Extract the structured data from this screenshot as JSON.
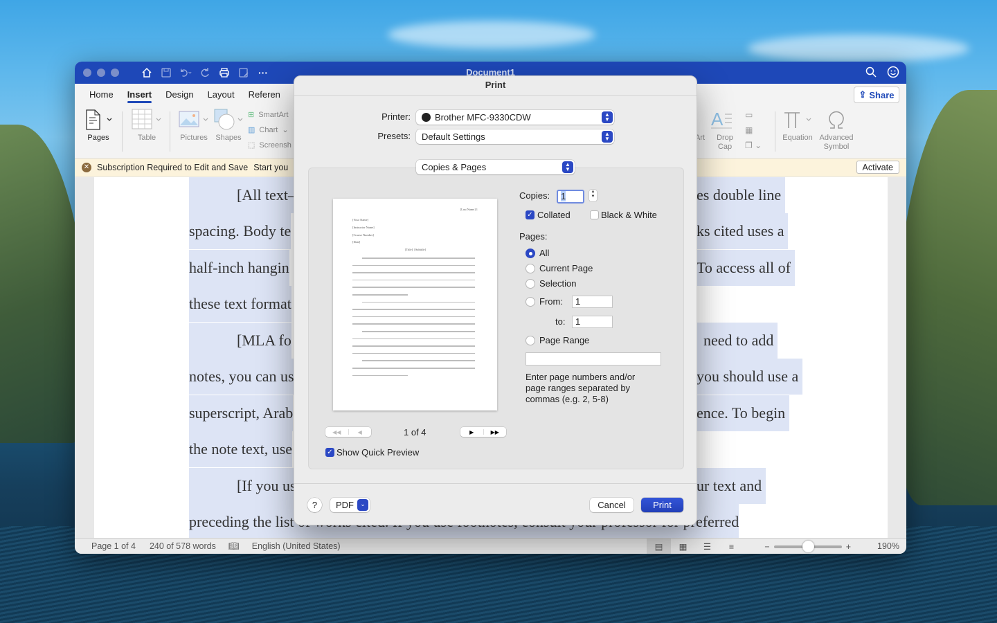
{
  "window": {
    "title": "Document1",
    "traffic_lights": [
      "close",
      "minimize",
      "zoom"
    ],
    "quick_access": [
      "home-icon",
      "save-icon",
      "undo-icon",
      "redo-icon",
      "print-icon",
      "save-as-icon",
      "more-icon"
    ]
  },
  "ribbon": {
    "tabs": [
      {
        "label": "Home",
        "active": false
      },
      {
        "label": "Insert",
        "active": true
      },
      {
        "label": "Design",
        "active": false
      },
      {
        "label": "Layout",
        "active": false
      },
      {
        "label": "Referen",
        "active": false
      }
    ],
    "share_label": "Share",
    "groups": {
      "pages": "Pages",
      "table": "Table",
      "pictures": "Pictures",
      "shapes": "Shapes",
      "smartart": "SmartArt",
      "chart": "Chart",
      "screenshot": "Screensh",
      "wordart_partial": "Art",
      "dropcap": "Drop Cap",
      "equation": "Equation",
      "advanced_symbol": "Advanced Symbol"
    }
  },
  "message_bar": {
    "title": "Subscription Required to Edit and Save",
    "text": "Start you",
    "activate_label": "Activate"
  },
  "document": {
    "left_lines": [
      "[All text–",
      "spacing. Body te",
      "half-inch hangin",
      "these text format",
      "[MLA fo",
      "notes, you can us",
      "superscript, Arab",
      "the note text, use",
      "[If you us",
      "preceding the list of works cited. If you use footnotes, consult your professor for preferred"
    ],
    "right_lines": [
      "es double line",
      "ks cited uses a",
      "To access all of",
      "",
      "need to add",
      "you should use a",
      "ence. To begin",
      "",
      "ur text and",
      ""
    ]
  },
  "statusbar": {
    "page": "Page 1 of 4",
    "words": "240 of 578 words",
    "language": "English (United States)",
    "zoom": "190%",
    "zoom_fraction": 0.5
  },
  "print_dialog": {
    "title": "Print",
    "printer_label": "Printer:",
    "printer_value": "Brother MFC-9330CDW",
    "presets_label": "Presets:",
    "presets_value": "Default Settings",
    "section_value": "Copies & Pages",
    "copies_label": "Copies:",
    "copies_value": "1",
    "collated_label": "Collated",
    "collated_checked": true,
    "bw_label": "Black & White",
    "bw_checked": false,
    "pages_label": "Pages:",
    "pages_options": [
      {
        "label": "All",
        "selected": true
      },
      {
        "label": "Current Page",
        "selected": false
      },
      {
        "label": "Selection",
        "selected": false
      },
      {
        "label": "From:",
        "selected": false
      },
      {
        "label": "Page Range",
        "selected": false
      }
    ],
    "from_value": "1",
    "to_label": "to:",
    "to_value": "1",
    "page_range_value": "",
    "help_text": "Enter page numbers and/or page ranges separated by commas (e.g. 2, 5-8)",
    "page_indicator": "1 of 4",
    "quick_preview_label": "Show Quick Preview",
    "quick_preview_checked": true,
    "help_button": "?",
    "pdf_label": "PDF",
    "cancel_label": "Cancel",
    "print_label": "Print",
    "preview": {
      "header": "[Last Name] 1",
      "lines": [
        "[Your Name]",
        "[Instructor Name]",
        "[Course Number]",
        "[Date]"
      ],
      "title": "[Title]: [Subtitle]"
    }
  }
}
